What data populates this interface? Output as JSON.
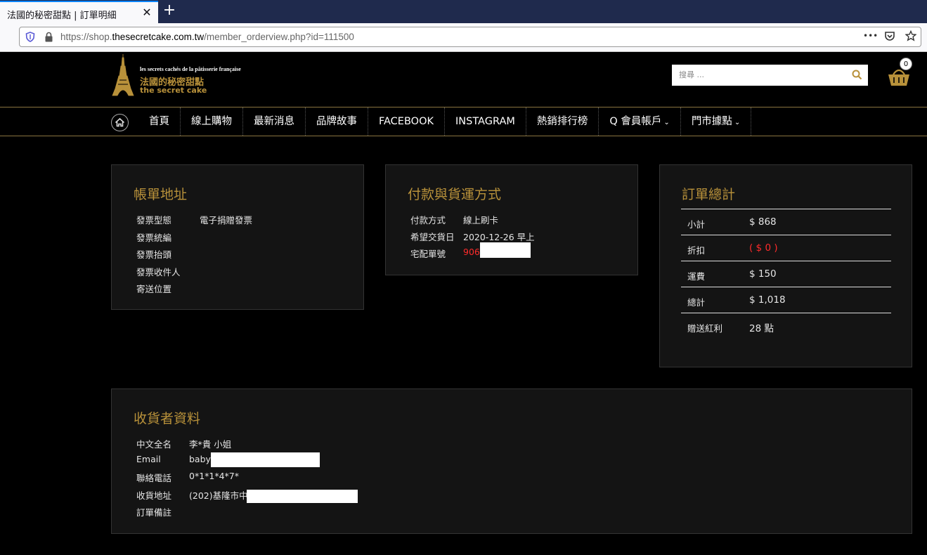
{
  "browser": {
    "tab_title": "法國的秘密甜點 | 訂單明細",
    "tab_close": "✕",
    "new_tab": "+",
    "url_prefix": "https://shop.",
    "url_host": "thesecretcake.com.tw",
    "url_path": "/member_orderview.php?id=111500",
    "more_icon": "•••"
  },
  "header": {
    "logo_line1": "les secrets cachés de la pâtisserie française",
    "logo_line2": "法國的秘密甜點",
    "logo_line3": "the secret cake",
    "search_placeholder": "搜尋 ...",
    "cart_count": "0",
    "accent_color": "#b8913a"
  },
  "nav": {
    "items": [
      {
        "label": "首頁"
      },
      {
        "label": "線上購物"
      },
      {
        "label": "最新消息"
      },
      {
        "label": "品牌故事"
      },
      {
        "label": "FACEBOOK"
      },
      {
        "label": "INSTAGRAM"
      },
      {
        "label": "熱銷排行榜"
      },
      {
        "label": "Q 會員帳戶"
      },
      {
        "label": "門市據點"
      }
    ],
    "chevron": "⌄"
  },
  "billing": {
    "title": "帳單地址",
    "rows": [
      {
        "label": "發票型態",
        "value": "電子捐贈發票"
      },
      {
        "label": "發票統編",
        "value": ""
      },
      {
        "label": "發票抬頭",
        "value": ""
      },
      {
        "label": "發票收件人",
        "value": ""
      },
      {
        "label": "寄送位置",
        "value": ""
      }
    ]
  },
  "payment": {
    "title": "付款與貨運方式",
    "rows": [
      {
        "label": "付款方式",
        "value": "線上刷卡"
      },
      {
        "label": "希望交貨日",
        "value": "2020-12-26 早上"
      },
      {
        "label": "宅配單號",
        "value": "906"
      }
    ],
    "tracking_color": "#ff2b2b"
  },
  "totals": {
    "title": "訂單總計",
    "rows": [
      {
        "label": "小計",
        "value": "$ 868"
      },
      {
        "label": "折扣",
        "value": "( $ 0 )"
      },
      {
        "label": "運費",
        "value": "$ 150"
      },
      {
        "label": "總計",
        "value": "$ 1,018"
      },
      {
        "label": "贈送紅利",
        "value": "28 點"
      }
    ],
    "discount_color": "#ff2b2b"
  },
  "recipient": {
    "title": "收貨者資料",
    "rows": [
      {
        "label": "中文全名",
        "value": "李*貴 小姐"
      },
      {
        "label": "Email",
        "value": "baby"
      },
      {
        "label": "聯絡電話",
        "value": "0*1*1*4*7*"
      },
      {
        "label": "收貨地址",
        "value": "(202)基隆市中"
      },
      {
        "label": "訂單備註",
        "value": ""
      }
    ]
  }
}
